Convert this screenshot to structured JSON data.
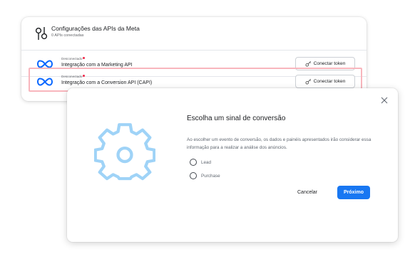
{
  "api_card": {
    "title": "Configurações das APIs da Meta",
    "subtitle": "0 APIs conectadas",
    "rows": [
      {
        "status": "Desconectado",
        "label": "Integração com a Marketing API",
        "button": "Conectar token"
      },
      {
        "status": "Desconectado",
        "label": "Integração com a Conversion API (CAPI)",
        "button": "Conectar token"
      }
    ]
  },
  "modal": {
    "title": "Escolha um sinal de conversão",
    "description": "Ao escolher um evento de conversão, os dados e painéis apresentados irão considerar essa informação para a realizar a análise dos anúncios.",
    "options": [
      "Lead",
      "Purchase"
    ],
    "cancel_label": "Cancelar",
    "next_label": "Próximo"
  },
  "colors": {
    "primary": "#1877f2",
    "highlight": "#f8b6bd",
    "gear": "#9fd3f7",
    "status_dot": "#f02849"
  },
  "icons": [
    "api-settings-icon",
    "meta-logo-icon",
    "token-key-icon",
    "close-icon",
    "gear-icon"
  ]
}
